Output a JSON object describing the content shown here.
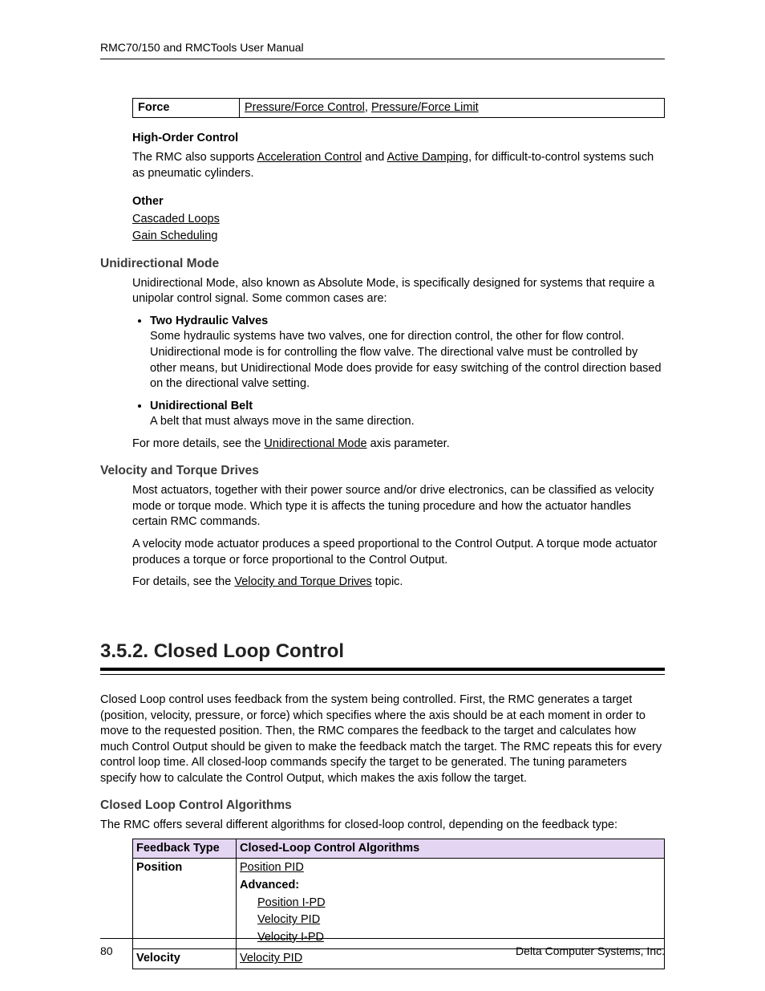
{
  "header": {
    "running": "RMC70/150 and RMCTools User Manual"
  },
  "top_table": {
    "row_label": "Force",
    "row_value_a": "Pressure/Force Control",
    "sep": ", ",
    "row_value_b": "Pressure/Force Limit"
  },
  "high_order": {
    "heading": "High-Order Control",
    "text_a": "The RMC also supports ",
    "link_a": "Acceleration Control",
    "text_b": " and ",
    "link_b": "Active Damping",
    "text_c": ", for difficult-to-control systems such as pneumatic cylinders."
  },
  "other": {
    "heading": "Other",
    "link_a": "Cascaded Loops",
    "link_b": "Gain Scheduling"
  },
  "uni": {
    "heading": "Unidirectional Mode",
    "intro": "Unidirectional Mode, also known as Absolute Mode, is specifically designed for systems that require a unipolar control signal. Some common cases are:",
    "b1_head": "Two Hydraulic Valves",
    "b1_body": "Some hydraulic systems have two valves, one for direction control, the other for flow control. Unidirectional mode is for controlling the flow valve. The directional valve must be controlled by other means, but Unidirectional Mode does provide for easy switching of the control direction based on the directional valve setting.",
    "b2_head": "Unidirectional Belt",
    "b2_body": "A belt that must always move in the same direction.",
    "more_a": "For more details, see the ",
    "more_link": "Unidirectional Mode",
    "more_b": " axis parameter."
  },
  "vel": {
    "heading": "Velocity and Torque Drives",
    "p1": "Most actuators, together with their power source and/or drive electronics, can be classified as velocity mode or torque mode. Which type it is affects the tuning procedure and how the actuator handles certain RMC commands.",
    "p2": "A velocity mode actuator produces a speed proportional to the Control Output. A torque mode actuator produces a torque or force proportional to the Control Output.",
    "p3a": "For details, see the ",
    "p3link": "Velocity and Torque Drives",
    "p3b": " topic."
  },
  "clc": {
    "heading": "3.5.2. Closed Loop Control",
    "intro": "Closed Loop control uses feedback from the system being controlled. First, the RMC generates a target (position, velocity, pressure, or force) which specifies where the axis should be at each moment in order to move to the requested position. Then, the RMC compares the feedback to the target and calculates how much Control Output should be given to make the feedback match the target. The RMC repeats this for every control loop time. All closed-loop commands specify the target to be generated. The tuning parameters specify how to calculate the Control Output, which makes the axis follow the target.",
    "algo_heading": "Closed Loop Control Algorithms",
    "algo_intro": "The RMC offers several different algorithms for closed-loop control, depending on the feedback type:",
    "th1": "Feedback Type",
    "th2": "Closed-Loop Control Algorithms",
    "r1_ft": "Position",
    "r1_l1": "Position PID",
    "r1_adv": "Advanced:",
    "r1_a1": "Position I-PD",
    "r1_a2": "Velocity PID",
    "r1_a3": "Velocity I-PD",
    "r2_ft": "Velocity",
    "r2_l1": "Velocity PID"
  },
  "footer": {
    "page": "80",
    "company": "Delta Computer Systems, Inc."
  }
}
